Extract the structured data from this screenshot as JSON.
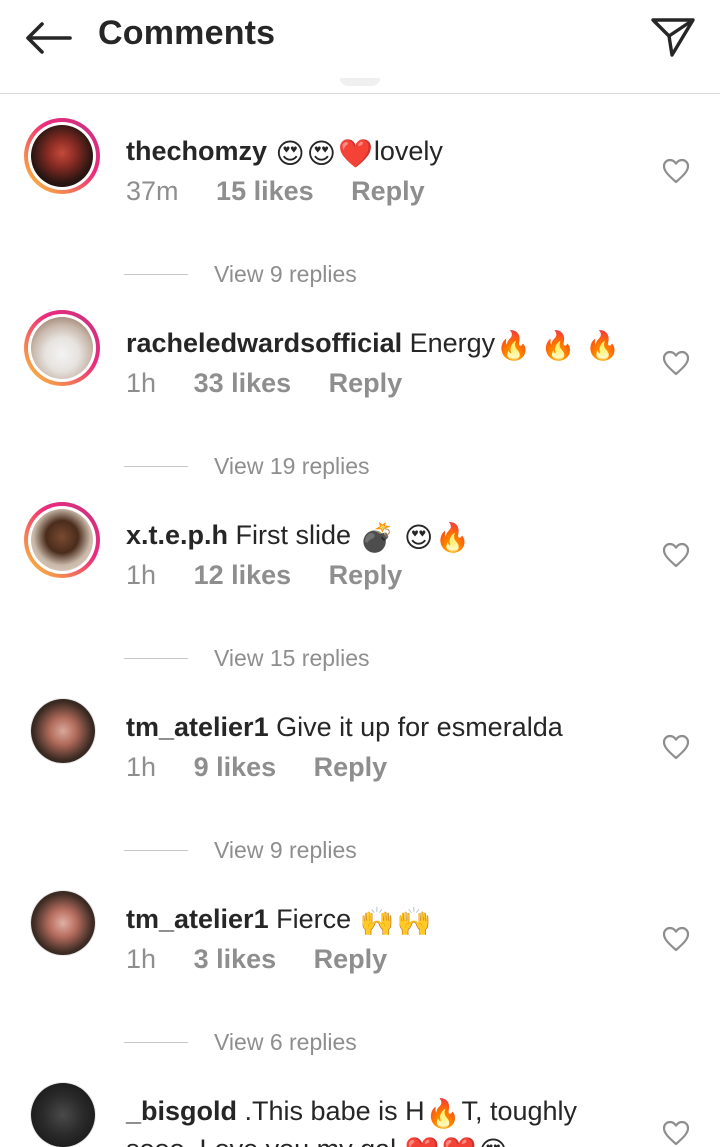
{
  "header": {
    "title": "Comments",
    "back_icon": "arrow-left-icon",
    "share_icon": "paper-plane-icon"
  },
  "comments": [
    {
      "username": "thechomzy",
      "text": "lovely",
      "emojis": [
        "😍",
        "😍",
        "❤️"
      ],
      "time": "37m",
      "likes": "15 likes",
      "reply": "Reply",
      "view_replies": "View 9 replies"
    },
    {
      "username": "racheledwardsofficial",
      "text": "Energy",
      "emojis": [
        "🔥",
        "🔥",
        "🔥"
      ],
      "time": "1h",
      "likes": "33 likes",
      "reply": "Reply",
      "view_replies": "View 19 replies"
    },
    {
      "username": "x.t.e.p.h",
      "text": "First slide",
      "emojis": [
        "💣",
        "😍",
        "🔥"
      ],
      "time": "1h",
      "likes": "12 likes",
      "reply": "Reply",
      "view_replies": "View 15 replies"
    },
    {
      "username": "tm_atelier1",
      "text": "Give it up for  esmeralda",
      "emojis": [],
      "time": "1h",
      "likes": "9 likes",
      "reply": "Reply",
      "view_replies": "View 9 replies"
    },
    {
      "username": "tm_atelier1",
      "text": "Fierce",
      "emojis": [
        "🙌",
        "🙌"
      ],
      "time": "1h",
      "likes": "3 likes",
      "reply": "Reply",
      "view_replies": "View 6 replies"
    },
    {
      "username": "_bisgold",
      "text_a": ".This babe is H",
      "emoji_mid": "🔥",
      "text_b": "T, toughly sooo. Love you my gal",
      "emojis_end": [
        "❤️",
        "❤️",
        "😍"
      ]
    }
  ],
  "colors": {
    "text": "#262626",
    "secondary": "#8e8e8e",
    "divider": "#dbdbdb",
    "story_ring_start": "#f9ce34",
    "story_ring_end": "#c13584"
  }
}
